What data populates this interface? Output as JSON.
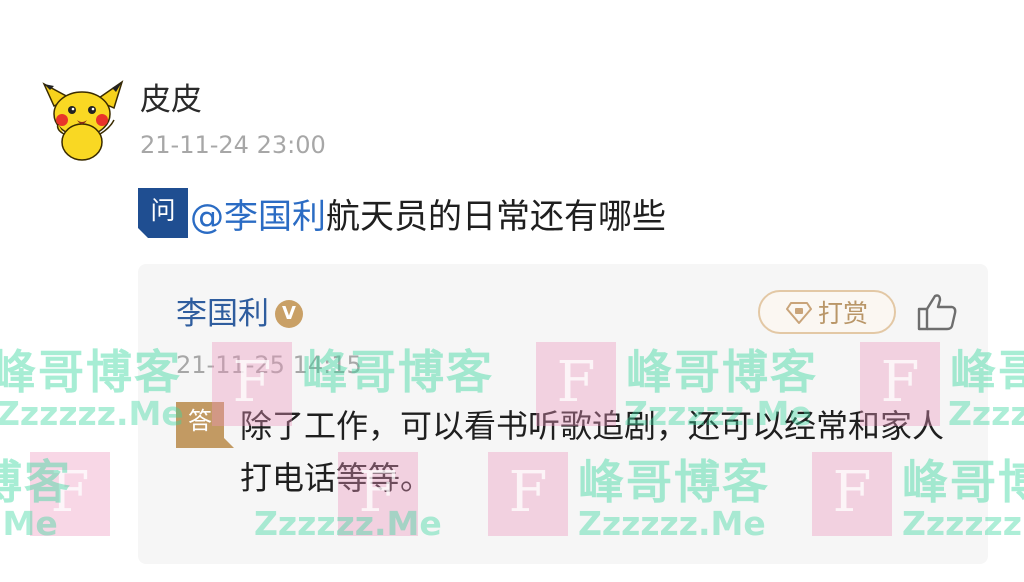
{
  "question": {
    "asker": {
      "avatar_icon": "pikachu-avatar",
      "name": "皮皮",
      "timestamp": "21-11-24 23:00"
    },
    "badge_label": "问",
    "mention": "@李国利",
    "text": "航天员的日常还有哪些"
  },
  "answer": {
    "answerer": {
      "name": "李国利",
      "verified_icon": "verified-v-icon",
      "verified_label": "V",
      "timestamp": "21-11-25 14:15"
    },
    "tip_button": {
      "icon": "gem-icon",
      "label": "打赏"
    },
    "like_icon": "thumbs-up-icon",
    "badge_label": "答",
    "text": "除了工作，可以看书听歌追剧，还可以经常和家人打电话等等。"
  },
  "watermark": {
    "brand_cn": "峰哥博客",
    "brand_en": "Zzzzzz.Me",
    "tile_letter": "F"
  },
  "colors": {
    "question_badge": "#1f4e91",
    "mention": "#2b6cc4",
    "answerer_name": "#2f5d9e",
    "answer_badge": "#c29a63",
    "tip_border": "#e3c8a5",
    "timestamp": "#a7a7a7",
    "card_background": "#f6f6f6"
  }
}
